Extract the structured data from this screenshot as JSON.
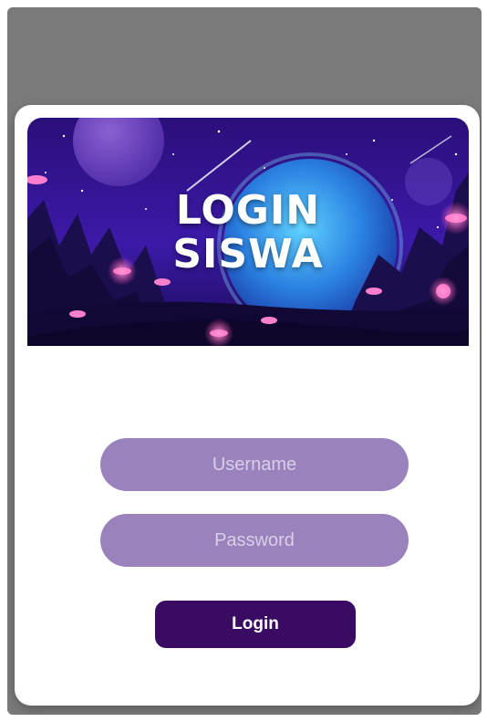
{
  "banner": {
    "title_line1": "LOGIN",
    "title_line2": "SISWA"
  },
  "form": {
    "username_placeholder": "Username",
    "password_placeholder": "Password",
    "login_label": "Login"
  },
  "colors": {
    "backdrop": "#7a7a7a",
    "card": "#ffffff",
    "field_bg": "#9a83bd",
    "field_text": "#d9cfe9",
    "button_bg": "#3a0b63",
    "button_text": "#ffffff"
  }
}
